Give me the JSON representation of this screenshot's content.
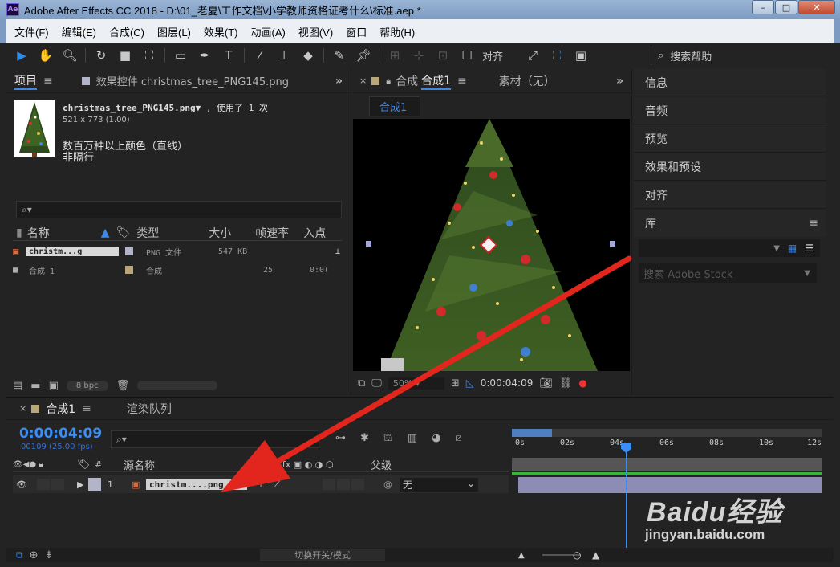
{
  "window": {
    "title": "Adobe After Effects CC 2018 - D:\\01_老夏\\工作文档\\小学教师资格证考什么\\标准.aep *",
    "app_badge": "Ae",
    "minimize": "–",
    "maximize": "□",
    "close": "✕"
  },
  "menu": [
    "文件(F)",
    "编辑(E)",
    "合成(C)",
    "图层(L)",
    "效果(T)",
    "动画(A)",
    "视图(V)",
    "窗口",
    "帮助(H)"
  ],
  "toolbar": {
    "align_label": "对齐",
    "search_help": "搜索帮助"
  },
  "project_panel": {
    "tab_project": "项目",
    "tab_effects": "效果控件 christmas_tree_PNG145.png",
    "expand": "»",
    "file_name": "christmas_tree_PNG145.png▼",
    "used": ", 使用了 1 次",
    "dimensions": "521 x 773 (1.00)",
    "color_line1": "数百万种以上颜色（直线）",
    "color_line2": "非隔行",
    "columns": [
      "名称",
      "类型",
      "大小",
      "帧速率",
      "入点"
    ],
    "items": [
      {
        "name": "christm...g",
        "type": "PNG 文件",
        "size": "547 KB",
        "fps": "",
        "in": ""
      },
      {
        "name": "合成 1",
        "type": "合成",
        "size": "",
        "fps": "25",
        "in": "0:0("
      }
    ],
    "bit_depth": "8 bpc"
  },
  "comp_panel": {
    "close": "×",
    "lock": "🔒",
    "tab_label": "合成",
    "tab_active": "合成1",
    "tab_material": "素材（无）",
    "expand": "»",
    "subtab": "合成1",
    "timecode": "0:00:04:09",
    "zoom": "50%"
  },
  "right_panel": {
    "items": [
      "信息",
      "音频",
      "预览",
      "效果和预设",
      "对齐",
      "库"
    ],
    "stock_search": "搜索 Adobe Stock"
  },
  "timeline": {
    "close": "×",
    "tab_comp": "合成1",
    "tab_render": "渲染队列",
    "timecode": "0:00:04:09",
    "frames": "00109 (25.00 fps)",
    "col_source": "源名称",
    "col_parent": "父级",
    "layer_num": "1",
    "layer_name": "christm....png",
    "parent_value": "无",
    "ruler": [
      "0s",
      "02s",
      "04s",
      "06s",
      "08s",
      "10s",
      "12s"
    ],
    "footer_toggle": "切换开关/模式",
    "fx_label": "fx"
  },
  "watermark": {
    "brand": "Baidu经验",
    "url": "jingyan.baidu.com"
  },
  "colors": {
    "accent": "#4187e6",
    "arrow": "#e3261d",
    "timecode": "#3b8ef5"
  }
}
